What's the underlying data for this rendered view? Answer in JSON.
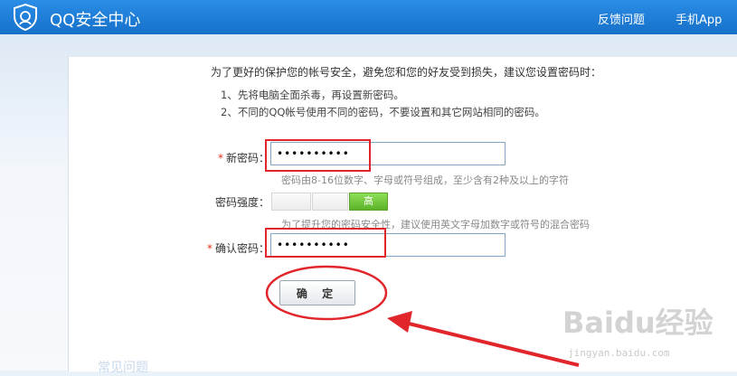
{
  "header": {
    "brand": "QQ安全中心",
    "nav": [
      {
        "label": "反馈问题"
      },
      {
        "label": "手机App"
      }
    ]
  },
  "form": {
    "heading": "为了更好的保护您的帐号安全，避免您和您的好友受到损失，建议您设置密码时：",
    "tips": [
      "1、先将电脑全面杀毒，再设置新密码。",
      "2、不同的QQ帐号使用不同的密码，不要设置和其它网站相同的密码。"
    ],
    "required_mark": "*",
    "new_password": {
      "label": "新密码：",
      "value": "••••••••••",
      "hint": "密码由8-16位数字、字母或符号组成，至少含有2种及以上的字符"
    },
    "strength": {
      "label": "密码强度：",
      "segments": [
        "",
        "",
        "高"
      ],
      "active_level": 3,
      "hint": "为了提升您的密码安全性，建议使用英文字母加数字或符号的混合密码"
    },
    "confirm_password": {
      "label": "确认密码：",
      "value": "••••••••••"
    },
    "submit_label": "确 定"
  },
  "colors": {
    "header_bg": "#1a7fdb",
    "annotation_red": "#e0252b",
    "strength_green": "#5bb32a"
  },
  "watermark": {
    "logo_text": "Baidu经验",
    "sub_text": "jingyan.baidu.com"
  },
  "footer": {
    "partial_link": "常见问题"
  }
}
